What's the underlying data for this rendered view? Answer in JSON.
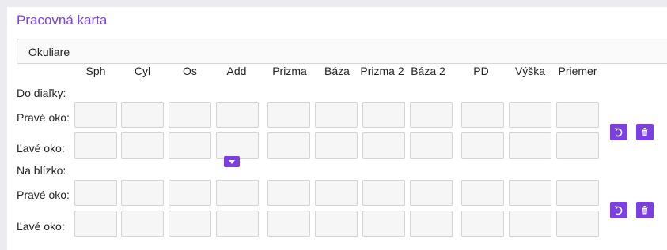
{
  "card": {
    "title": "Pracovná karta"
  },
  "type_select": {
    "value": "Okuliare"
  },
  "columns": [
    "Sph",
    "Cyl",
    "Os",
    "Add",
    "Prizma",
    "Báza",
    "Prizma 2",
    "Báza 2",
    "PD",
    "Výška",
    "Priemer"
  ],
  "sections": {
    "distance": {
      "label": "Do diaľky:"
    },
    "near": {
      "label": "Na blízko:"
    }
  },
  "rows": {
    "right_eye": "Pravé oko:",
    "left_eye": "Ľavé oko:"
  },
  "icons": {
    "reset": "rotate-icon",
    "delete": "trash-icon",
    "dropdown": "caret-down-icon"
  },
  "colors": {
    "accent": "#7b3fe4"
  }
}
